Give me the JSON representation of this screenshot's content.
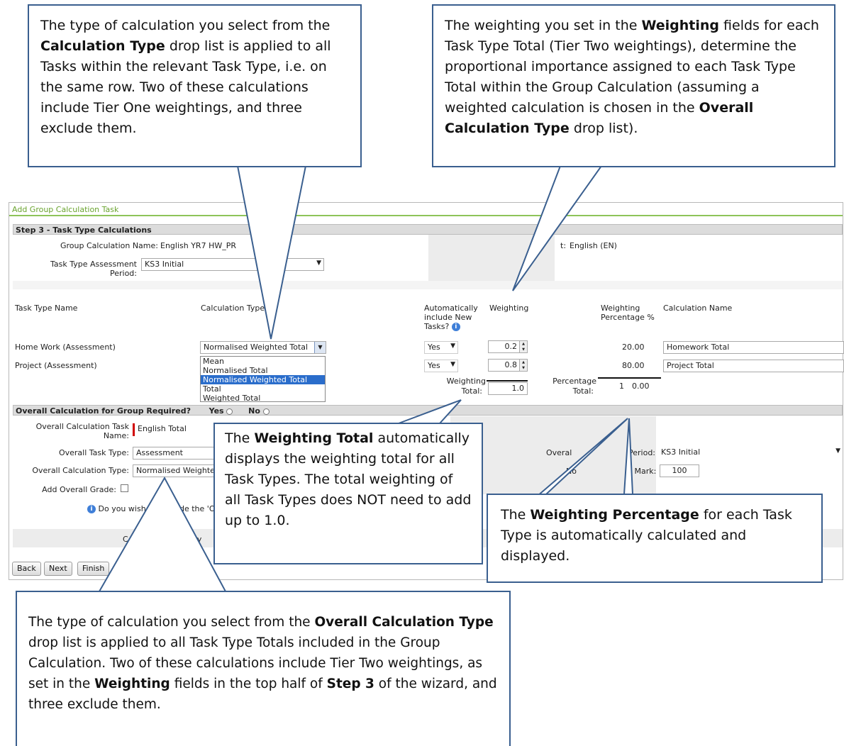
{
  "window": {
    "title": "Add Group Calculation Task"
  },
  "step": {
    "header": "Step 3 - Task Type Calculations"
  },
  "group": {
    "calc_name_label": "Group Calculation Name:",
    "calc_name_value": "English YR7 HW_PR",
    "subject_label_partial": "t:",
    "subject_value": "English (EN)",
    "period_label_line1": "Task Type Assessment",
    "period_label_line2": "Period:",
    "period_value": "KS3 Initial"
  },
  "columns": {
    "task_type_name": "Task Type Name",
    "calculation_type": "Calculation Type",
    "auto_include_line1": "Automatically",
    "auto_include_line2": "include New",
    "auto_include_line3": "Tasks?",
    "weighting": "Weighting",
    "weighting_pct_line1": "Weighting",
    "weighting_pct_line2": "Percentage %",
    "calculation_name": "Calculation Name"
  },
  "rows": [
    {
      "name": "Home Work (Assessment)",
      "calc_type": "Normalised Weighted Total",
      "auto_include": "Yes",
      "weighting": "0.2",
      "percentage": "20.00",
      "calc_name": "Homework Total"
    },
    {
      "name": "Project (Assessment)",
      "calc_type": "",
      "auto_include": "Yes",
      "weighting": "0.8",
      "percentage": "80.00",
      "calc_name": "Project Total"
    }
  ],
  "calc_type_options": [
    "Mean",
    "Normalised Total",
    "Normalised Weighted Total",
    "Total",
    "Weighted Total"
  ],
  "totals": {
    "weighting_label_line1": "Weighting",
    "weighting_label_line2": "Total:",
    "weighting_value": "1.0",
    "percentage_label_line1": "Percentage",
    "percentage_label_line2": "Total:",
    "percentage_value_start": "1",
    "percentage_value_end": "0.00"
  },
  "overall": {
    "header": "Overall Calculation for Group Required?",
    "yes_label": "Yes",
    "no_label_partial": "No",
    "task_name_label_line1": "Overall Calculation Task",
    "task_name_label_line2": "Name:",
    "task_name_value": "English Total",
    "task_type_label": "Overall Task Type:",
    "task_type_value": "Assessment",
    "calc_type_label": "Overall Calculation Type:",
    "calc_type_value": "Normalised Weighte",
    "add_grade_label": "Add Overall Grade:",
    "period_label_start": "Overal",
    "period_label_end": "Period:",
    "period_value": "KS3 Initial",
    "mark_label_start": "No",
    "mark_label_end": "n Mark:",
    "mark_value": "100",
    "include_question_start": "Do you wish",
    "include_question_end": "de the 'O",
    "partial_c": "C",
    "partial_ally": "ally"
  },
  "buttons": {
    "back": "Back",
    "next": "Next",
    "finish": "Finish"
  },
  "callouts": {
    "calc_type": {
      "p1": "The type of calculation you select from the ",
      "b1": "Calculation Type",
      "p2": " drop list is applied to all Tasks within the relevant Task Type, i.e. on the same row. Two of these calculations include Tier One weightings, and three exclude them."
    },
    "weighting": {
      "p1": "The weighting you set in the ",
      "b1": "Weighting",
      "p2": " fields for each Task Type Total (Tier Two weightings), determine the proportional importance assigned to each Task Type Total within the Group Calculation (assuming a weighted calculation is chosen in the ",
      "b2": "Overall Calculation Type",
      "p3": " drop list)."
    },
    "weighting_total": {
      "p1": "The ",
      "b1": "Weighting Total",
      "p2": " automatically displays the weighting total for all Task Types. The total weighting of all Task Types does NOT need to add up to 1.0."
    },
    "weighting_pct": {
      "p1": "The ",
      "b1": "Weighting Percentage",
      "p2": " for each Task Type is automatically calculated and displayed."
    },
    "overall_calc": {
      "p1": "The type of calculation you select from the ",
      "b1": "Overall Calculation Type",
      "p2": " drop list is applied to all Task Type Totals included in the Group Calculation. Two of these calculations include Tier Two weightings, as set in the ",
      "b2": "Weighting",
      "p3": " fields in the top half of ",
      "b3": "Step 3",
      "p4": " of the wizard, and three exclude them."
    }
  },
  "colors": {
    "title_green": "#6aa42f",
    "callout_border": "#3a5f8f",
    "selected_blue": "#2a6dcb",
    "required_red": "#d00000"
  }
}
